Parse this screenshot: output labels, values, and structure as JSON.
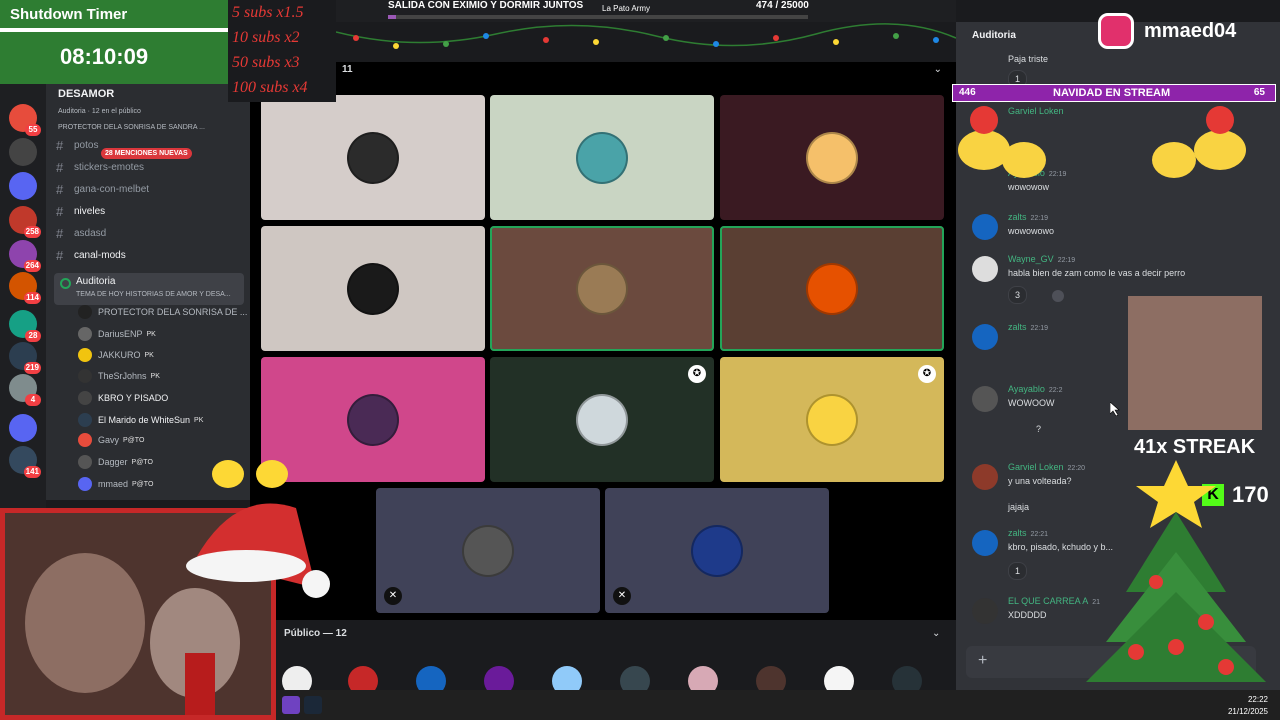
{
  "timer": {
    "title": "Shutdown Timer",
    "value": "08:10:09"
  },
  "subs_multipliers": [
    "5 subs x1.5",
    "10 subs x2",
    "50 subs x3",
    "100 subs x4"
  ],
  "top_banner": {
    "title": "SALIDA CON EXIMIO Y DORMIR JUNTOS",
    "army": "La Pato Army",
    "count": "474  / 25000",
    "progress": 0.019
  },
  "stage": {
    "count": "11",
    "public_label": "Público — 12"
  },
  "sidebar": {
    "server_name": "DESAMOR",
    "server_sub": "Auditoria · 12 en el público",
    "server_sub2": "PROTECTOR DELA SONRISA DE SANDRA ...",
    "mentions_badge": "28 MENCIONES NUEVAS",
    "channels": [
      {
        "name": "potos",
        "bold": false
      },
      {
        "name": "stickers-emotes",
        "bold": false
      },
      {
        "name": "gana-con-melbet",
        "bold": false
      },
      {
        "name": "niveles",
        "bold": true
      },
      {
        "name": "asdasd",
        "bold": false
      },
      {
        "name": "canal-mods",
        "bold": true
      }
    ],
    "voice_channel": {
      "title": "Auditoria",
      "topic": "TEMA DE HOY HISTORIAS DE AMOR Y DESA..."
    },
    "members": [
      {
        "name": "PROTECTOR DELA SONRISA DE ...",
        "tag": "",
        "bold": false
      },
      {
        "name": "DariusENP",
        "tag": "PK",
        "bold": false
      },
      {
        "name": "JAKKURO",
        "tag": "PK",
        "bold": false
      },
      {
        "name": "TheSrJohns",
        "tag": "PK",
        "bold": false
      },
      {
        "name": "KBRO Y PISADO",
        "tag": "",
        "bold": true
      },
      {
        "name": "El Marido de WhiteSun",
        "tag": "PK",
        "bold": true
      },
      {
        "name": "Gavy",
        "tag": "P@TO",
        "bold": false
      },
      {
        "name": "Dagger",
        "tag": "P@TO",
        "bold": false
      },
      {
        "name": "mmaed",
        "tag": "P@TO",
        "bold": false
      }
    ],
    "server_badges": [
      "55",
      "1",
      "258",
      "264",
      "114",
      "28",
      "219",
      "4",
      "141"
    ]
  },
  "chat": {
    "header": "Auditoria",
    "messages": [
      {
        "author": "",
        "time": "",
        "text": "Paja triste",
        "author_color": "#dbdee1"
      },
      {
        "author": "Garviel Loken",
        "time": "",
        "text": "",
        "author_color": "#43b581"
      },
      {
        "author": "Ayayablo",
        "time": "22:19",
        "text": "wowowow",
        "author_color": "#43b581"
      },
      {
        "author": "zalts",
        "time": "22:19",
        "text": "wowowowo",
        "author_color": "#43b581"
      },
      {
        "author": "Wayne_GV",
        "time": "22:19",
        "text": "habla bien de zam como le vas a decir perro",
        "author_color": "#43b581"
      },
      {
        "author": "zalts",
        "time": "22:19",
        "text": "",
        "author_color": "#43b581"
      },
      {
        "author": "Ayayablo",
        "time": "22:2",
        "text": "WOWOOW",
        "author_color": "#43b581"
      },
      {
        "author": "Garviel Loken",
        "time": "22:20",
        "text": "y una volteada?",
        "author_color": "#43b581"
      },
      {
        "author": "zalts",
        "time": "22:21",
        "text": "kbro, pisado, kchudo y b...",
        "author_color": "#43b581"
      },
      {
        "author": "EL QUE CARREA A",
        "time": "21",
        "text": "XDDDDD",
        "author_color": "#43b581"
      }
    ],
    "plain_lines": {
      "jajaja": "jajaja",
      "question": "?"
    },
    "reactions": {
      "r1": "1",
      "r2": "3",
      "r3": "1"
    }
  },
  "instagram": {
    "handle": "mmaed04"
  },
  "christmas": {
    "title": "NAVIDAD EN STREAM",
    "left_count": "446",
    "right_count": "65"
  },
  "streak": {
    "label": "41x STREAK",
    "kick_count": "170"
  },
  "taskbar": {
    "time": "22:22",
    "date": "21/12/2025"
  },
  "colors": {
    "discord_bg": "#313338",
    "green": "#23a559",
    "timer_bg": "#2e7d32",
    "red": "#e53935"
  }
}
